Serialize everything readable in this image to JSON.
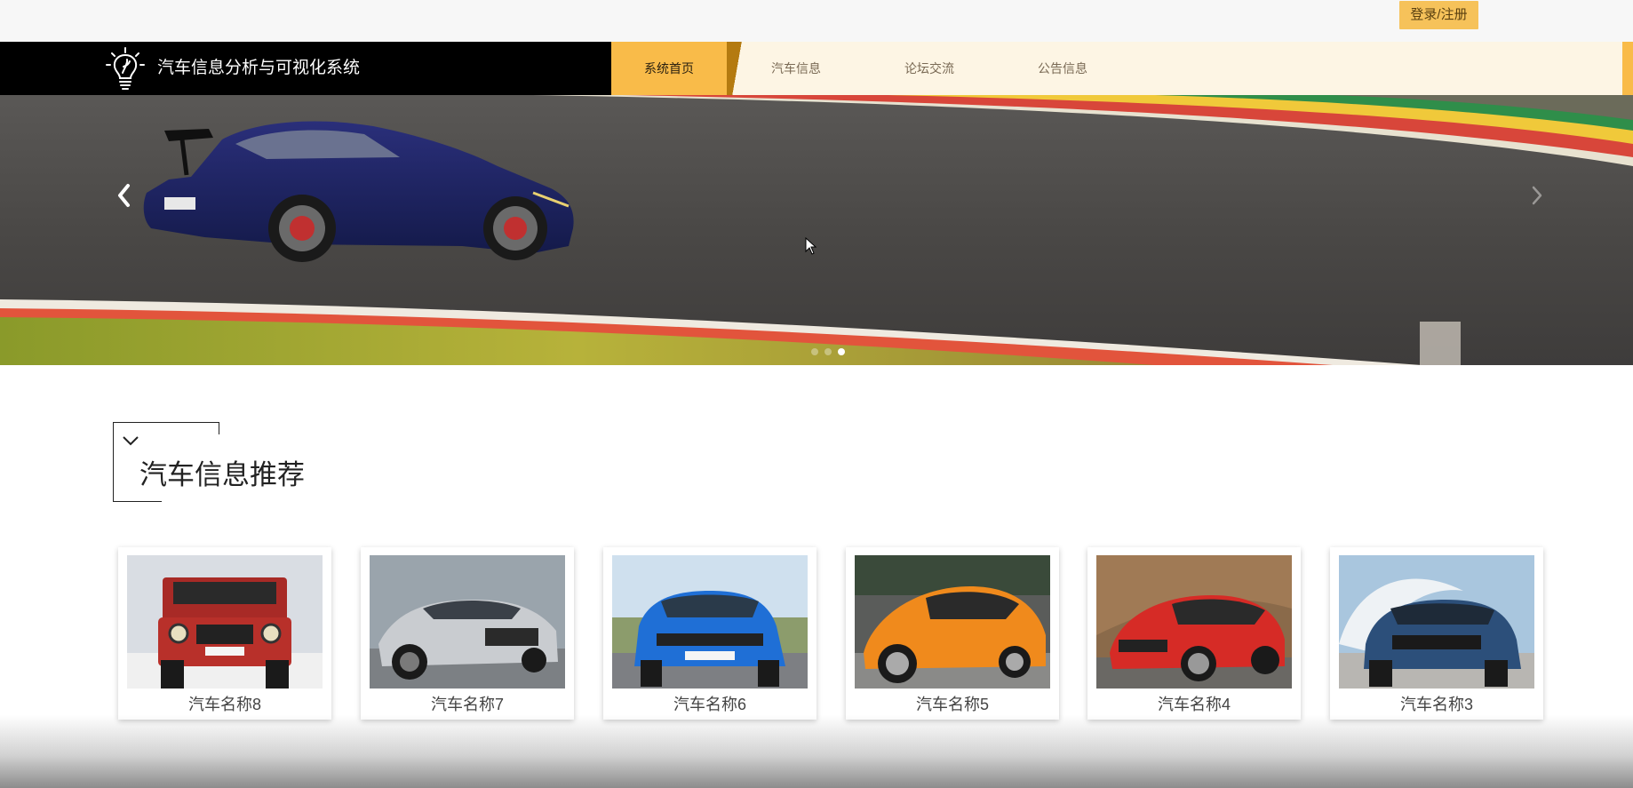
{
  "topbar": {
    "login_label": "登录/注册"
  },
  "brand": {
    "title": "汽车信息分析与可视化系统",
    "logo_icon": "lightbulb-icon"
  },
  "nav": {
    "items": [
      {
        "label": "系统首页",
        "active": true
      },
      {
        "label": "汽车信息",
        "active": false
      },
      {
        "label": "论坛交流",
        "active": false
      },
      {
        "label": "公告信息",
        "active": false
      }
    ]
  },
  "banner": {
    "prev_icon": "chevron-left-icon",
    "next_icon": "chevron-right-icon",
    "slide_count": 3,
    "active_slide": 3
  },
  "section": {
    "title": "汽车信息推荐",
    "icon": "chevron-down-icon"
  },
  "cars": [
    {
      "name": "汽车名称8",
      "color": "#b8302a"
    },
    {
      "name": "汽车名称7",
      "color": "#c9ccd0"
    },
    {
      "name": "汽车名称6",
      "color": "#1f6fd6"
    },
    {
      "name": "汽车名称5",
      "color": "#f08a1c"
    },
    {
      "name": "汽车名称4",
      "color": "#d62b26"
    },
    {
      "name": "汽车名称3",
      "color": "#2c4f7a"
    }
  ],
  "colors": {
    "accent": "#f9bb49",
    "nav_bg": "#fdf5e4",
    "brand_bg": "#000000"
  }
}
